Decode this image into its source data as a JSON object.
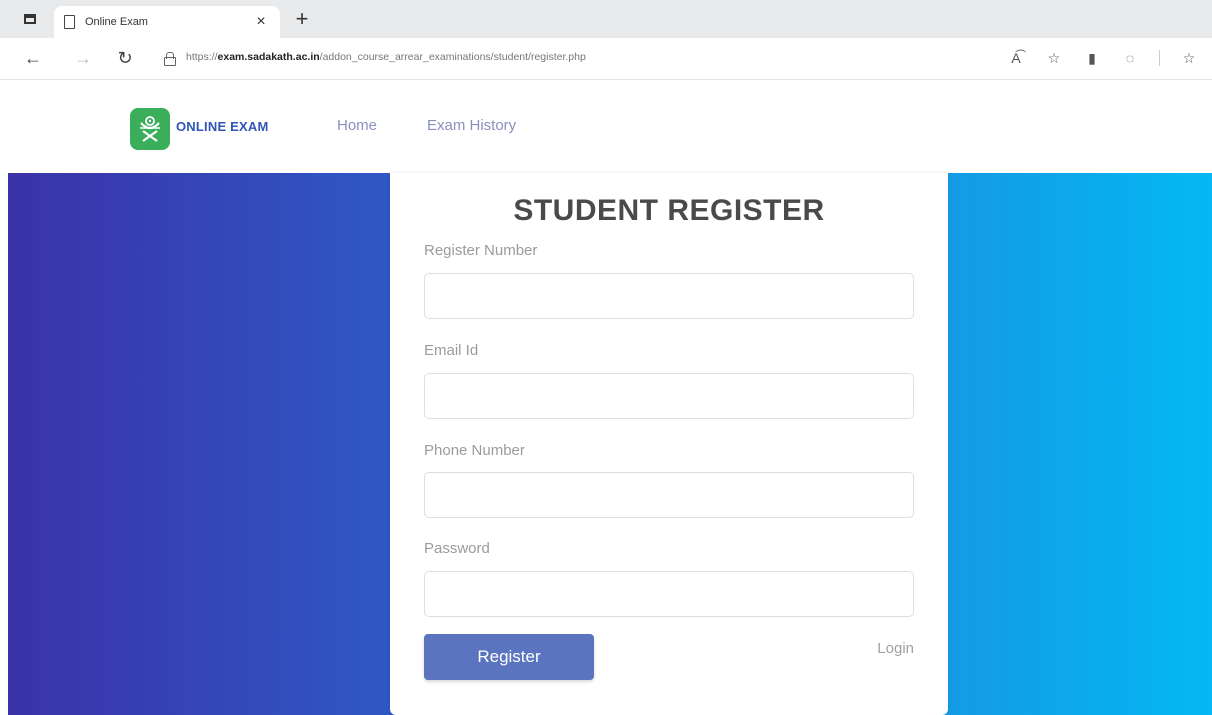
{
  "browser": {
    "tab_title": "Online Exam",
    "tab_close": "×",
    "new_tab": "+",
    "url_scheme": "https://",
    "url_host": "exam.sadakath.ac.in",
    "url_path": "/addon_course_arrear_examinations/student/register.php",
    "icons": [
      "back-icon",
      "forward-icon",
      "reload-icon",
      "lock-icon",
      "read-aloud-icon",
      "favorites-icon",
      "extension-icon",
      "browser-essentials-icon",
      "collections-icon"
    ]
  },
  "header": {
    "brand": "ONLINE EXAM",
    "nav": {
      "home": "Home",
      "history": "Exam History"
    }
  },
  "form": {
    "title": "STUDENT REGISTER",
    "register_number_label": "Register Number",
    "email_label": "Email Id",
    "phone_label": "Phone Number",
    "password_label": "Password",
    "register_number_value": "",
    "email_value": "",
    "phone_value": "",
    "password_value": "",
    "register_button": "Register",
    "login_link": "Login"
  },
  "colors": {
    "gradient_start": "#3b32a8",
    "gradient_end": "#04b8f4",
    "brand": "#2f56b8",
    "button": "#5b74c0",
    "logo_green": "#3aae5a"
  }
}
